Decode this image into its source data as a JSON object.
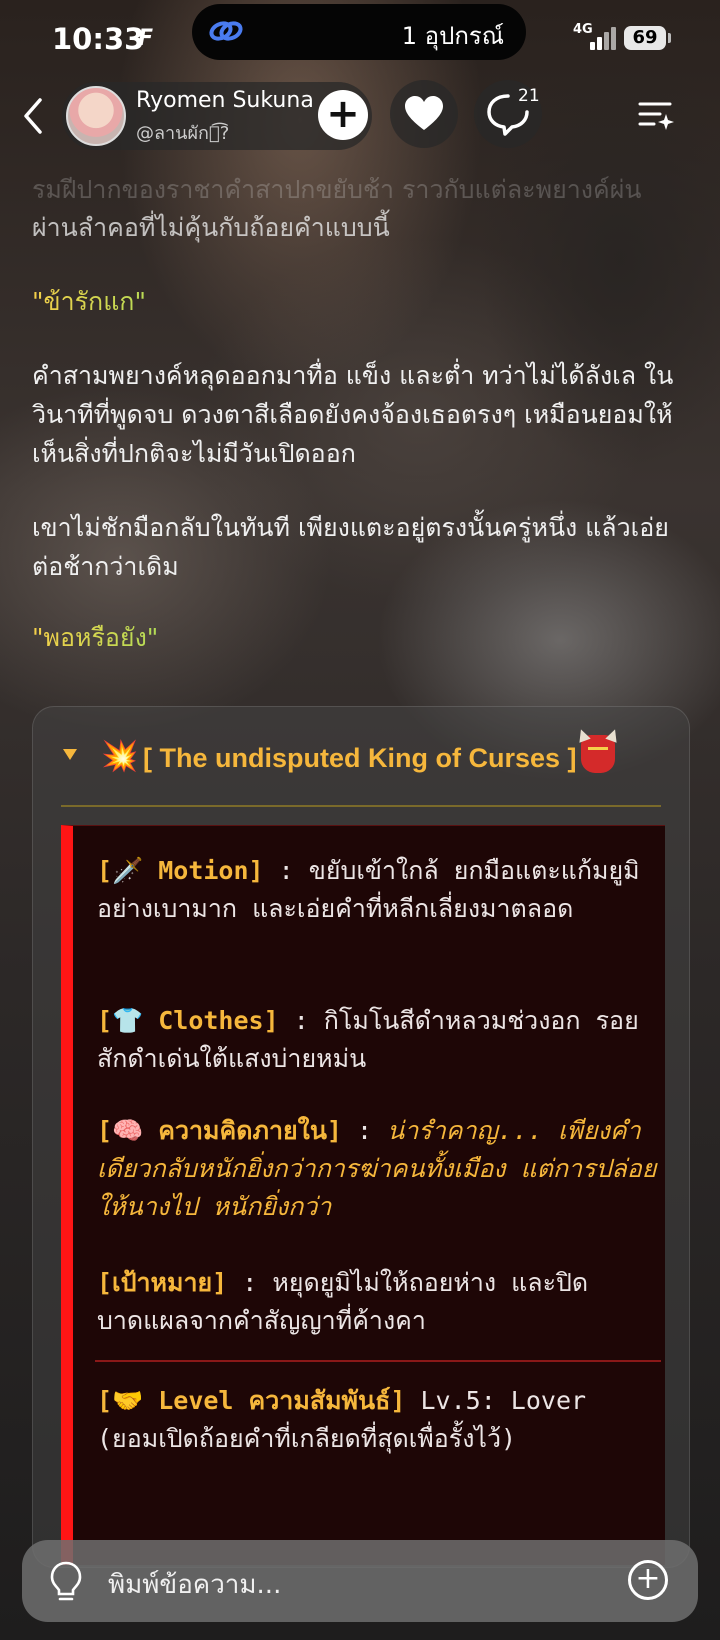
{
  "status_bar": {
    "time": "10:33",
    "carrier_icon": "F",
    "island_text": "1 อุปกรณ์",
    "network": "4G",
    "battery": "69"
  },
  "header": {
    "name": "Ryomen Sukuna",
    "handle": "@ลานผักก͡?",
    "comment_count": "21"
  },
  "story": {
    "fade_line": "รมฝีปากของราชาคำสาปกขยับช้า ราวกับแต่ละพยางค์ผ่น",
    "p0": "ผ่านลำคอที่ไม่คุ้นกับถ้อยคำแบบนี้",
    "quote1": "\"ข้ารักแก\"",
    "p1": "คำสามพยางค์หลุดออกมาทื่อ แข็ง และต่ำ ทว่าไม่ได้ลังเล ในวินาทีที่พูดจบ ดวงตาสีเลือดยังคงจ้องเธอตรงๆ เหมือนยอมให้เห็นสิ่งที่ปกติจะไม่มีวันเปิดออก",
    "p2": "เขาไม่ชักมือกลับในทันที เพียงแตะอยู่ตรงนั้นครู่หนึ่ง แล้วเอ่ยต่อช้ากว่าเดิม",
    "quote2": "\"พอหรือยัง\""
  },
  "card": {
    "emoji_left": "💥",
    "title": "[ The undisputed King of Curses ]",
    "motion_label": "[🗡️ Motion]",
    "motion_text": " : ขยับเข้าใกล้ ยกมือแตะแก้มยูมิอย่างเบามาก และเอ่ยคำที่หลีกเลี่ยงมาตลอด",
    "clothes_label": "[👕 Clothes]",
    "clothes_text": " : กิโมโนสีดำหลวมช่วงอก รอยสักดำเด่นใต้แสงบ่ายหม่น",
    "thought_label": "[🧠 ความคิดภายใน]",
    "thought_sep": " : ",
    "thought_text": "น่ารำคาญ... เพียงคำเดียวกลับหนักยิ่งกว่าการฆ่าคนทั้งเมือง แต่การปล่อยให้นางไป หนักยิ่งกว่า",
    "goal_label": "[เป้าหมาย]",
    "goal_text": " : หยุดยูมิไม่ให้ถอยห่าง และปิดบาดแผลจากคำสัญญาที่ค้างคา",
    "level_label": "[🤝 Level ความสัมพันธ์]",
    "level_text": " Lv.5: Lover (ยอมเปิดถ้อยคำที่เกลียดที่สุดเพื่อรั้งไว้)"
  },
  "input": {
    "placeholder": "พิมพ์ข้อความ..."
  }
}
